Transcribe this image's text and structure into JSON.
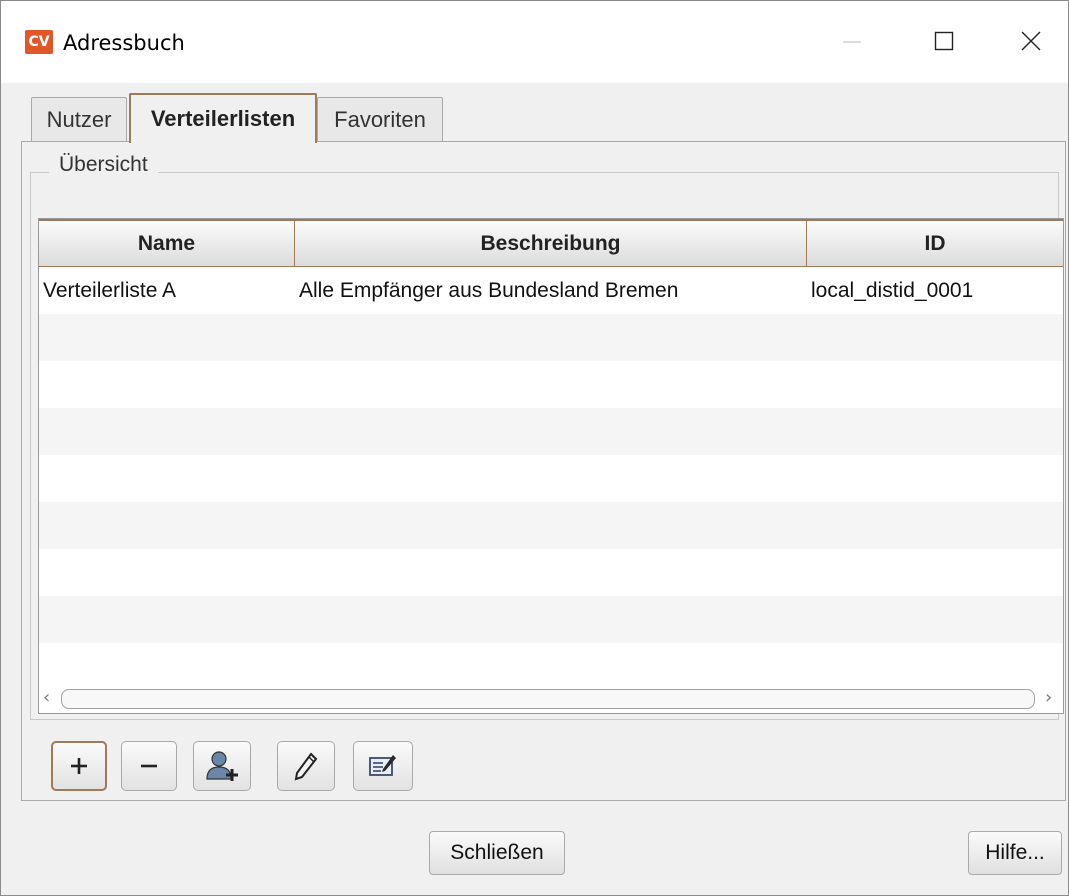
{
  "window": {
    "title": "Adressbuch",
    "app_icon_text": "CV"
  },
  "tabs": [
    {
      "label": "Nutzer",
      "active": false
    },
    {
      "label": "Verteilerlisten",
      "active": true
    },
    {
      "label": "Favoriten",
      "active": false
    }
  ],
  "group": {
    "title": "Übersicht"
  },
  "table": {
    "columns": [
      "Name",
      "Beschreibung",
      "ID"
    ],
    "rows": [
      [
        "Verteilerliste A",
        "Alle Empfänger aus Bundesland Bremen",
        "local_distid_0001"
      ]
    ]
  },
  "toolbar": {
    "buttons": [
      {
        "icon": "plus-icon"
      },
      {
        "icon": "minus-icon"
      },
      {
        "icon": "add-user-icon"
      },
      {
        "icon": "pencil-icon"
      },
      {
        "icon": "edit-list-icon"
      }
    ]
  },
  "footer": {
    "close_label": "Schließen",
    "help_label": "Hilfe..."
  },
  "colors": {
    "accent": "#9c7a5a",
    "app_icon": "#e0572a"
  }
}
